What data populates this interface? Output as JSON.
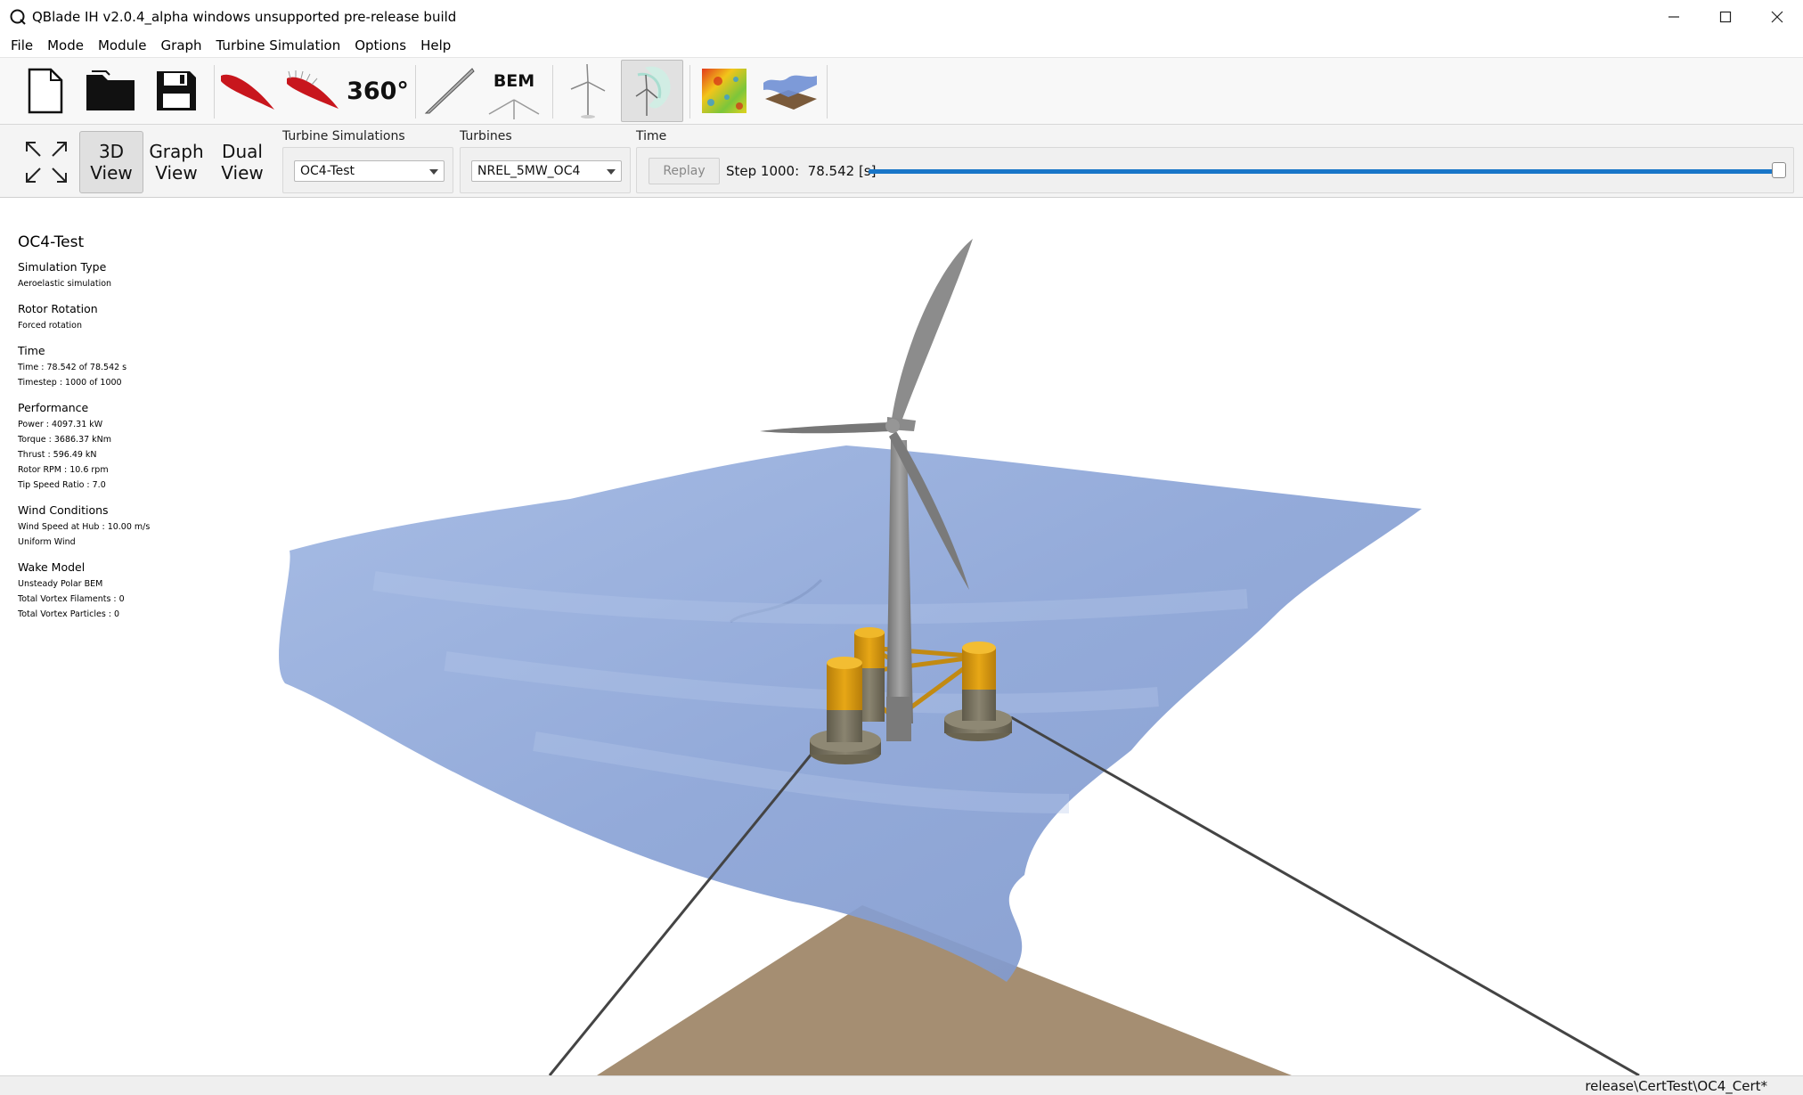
{
  "window": {
    "title": "QBlade IH v2.0.4_alpha windows unsupported pre-release build",
    "controls": {
      "minimize": "—",
      "maximize": "☐",
      "close": "✕"
    }
  },
  "menu": [
    "File",
    "Mode",
    "Module",
    "Graph",
    "Turbine Simulation",
    "Options",
    "Help"
  ],
  "toolbar": {
    "polar_360_label": "360°",
    "bem_label": "BEM",
    "icons": [
      "new-file-icon",
      "open-folder-icon",
      "save-icon",
      "airfoil-icon",
      "polar-icon",
      "polar-360-icon",
      "blade-icon",
      "bem-icon",
      "turbine-icon",
      "turbine-simulation-icon",
      "windfield-icon",
      "wave-icon"
    ],
    "active_module": "turbine-simulation"
  },
  "view_buttons": {
    "fullscreen": "fullscreen-icon",
    "three_d_line1": "3D",
    "three_d_line2": "View",
    "graph_line1": "Graph",
    "graph_line2": "View",
    "dual_line1": "Dual",
    "dual_line2": "View",
    "active": "3D View"
  },
  "simulation_selector": {
    "label": "Turbine Simulations",
    "value": "OC4-Test"
  },
  "turbine_selector": {
    "label": "Turbines",
    "value": "NREL_5MW_OC4"
  },
  "time_control": {
    "label": "Time",
    "replay_label": "Replay",
    "step_text": "Step 1000:  78.542 [s]",
    "progress": 1.0
  },
  "info": {
    "title": "OC4-Test",
    "sections": [
      {
        "head": "Simulation Type",
        "lines": [
          "Aeroelastic simulation"
        ]
      },
      {
        "head": "Rotor Rotation",
        "lines": [
          "Forced rotation"
        ]
      },
      {
        "head": "Time",
        "lines": [
          "Time : 78.542 of 78.542 s",
          "Timestep : 1000 of 1000"
        ]
      },
      {
        "head": "Performance",
        "lines": [
          "Power : 4097.31 kW",
          "Torque : 3686.37 kNm",
          "Thrust : 596.49 kN",
          "Rotor RPM : 10.6 rpm",
          "Tip Speed Ratio : 7.0"
        ]
      },
      {
        "head": "Wind Conditions",
        "lines": [
          "Wind Speed at Hub : 10.00 m/s",
          "Uniform Wind"
        ]
      },
      {
        "head": "Wake Model",
        "lines": [
          "Unsteady Polar BEM",
          "Total Vortex Filaments : 0",
          "Total Vortex Particles : 0"
        ]
      }
    ]
  },
  "status": {
    "path": "release\\CertTest\\OC4_Cert*"
  },
  "colors": {
    "accent": "#1976c8",
    "water": "#8ea8d8",
    "seabed": "#a58e72",
    "floater_top": "#d99a10",
    "floater_bottom": "#7c7660",
    "tower": "#8a8a8a"
  }
}
